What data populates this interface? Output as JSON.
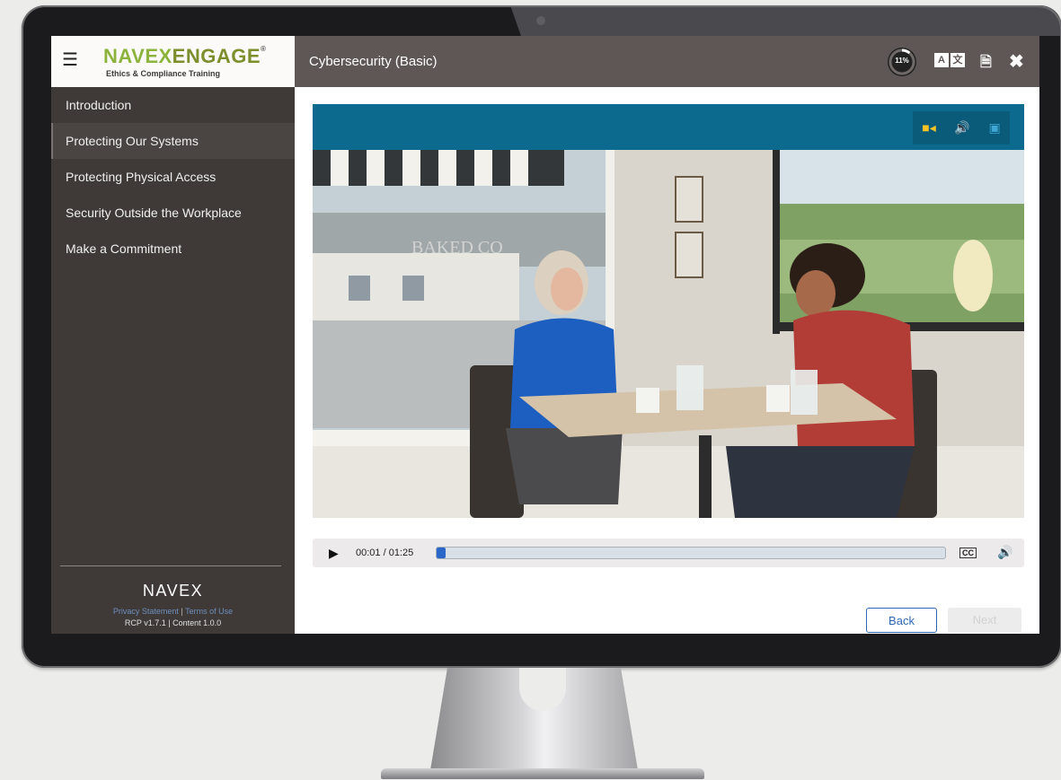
{
  "brand": {
    "logo_part1": "NAVEX",
    "logo_part2": "ENGAGE",
    "logo_mark": "®",
    "tagline": "Ethics & Compliance Training",
    "menu_icon": "hamburger-menu-icon"
  },
  "header": {
    "course_title": "Cybersecurity (Basic)",
    "progress_label": "11%",
    "progress_value": 0.11,
    "icons": [
      "translate-icon",
      "transcript-icon",
      "close-icon"
    ]
  },
  "sidebar": {
    "items": [
      {
        "label": "Introduction",
        "active": false
      },
      {
        "label": "Protecting Our Systems",
        "active": true
      },
      {
        "label": "Protecting Physical Access",
        "active": false
      },
      {
        "label": "Security Outside the Workplace",
        "active": false
      },
      {
        "label": "Make a Commitment",
        "active": false
      }
    ],
    "footer_logo": "NAVEX",
    "privacy_link": "Privacy Statement",
    "link_separator": "|",
    "terms_link": "Terms of Use",
    "version": "RCP v1.7.1 | Content 1.0.0"
  },
  "video": {
    "mode_icons": [
      "video-mode-icon",
      "audio-mode-icon",
      "image-mode-icon"
    ],
    "storefront_text": "BAKED CO",
    "time_display": "00:01 / 01:25",
    "progress": 0.012,
    "cc_label": "CC",
    "colors": {
      "header": "#0b6a8d",
      "accent": "#f7c325",
      "seek": "#2a66c7"
    }
  },
  "navigation": {
    "back_label": "Back",
    "next_label": "Next"
  }
}
